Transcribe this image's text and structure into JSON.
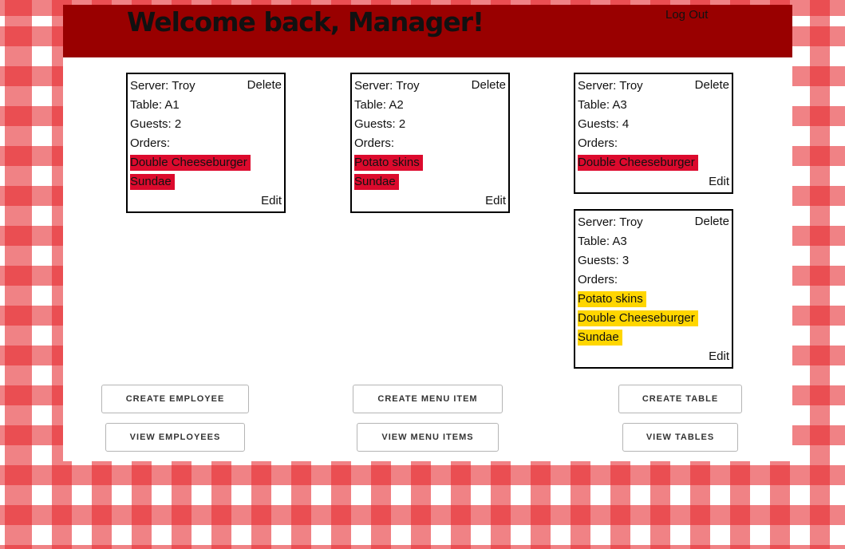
{
  "header": {
    "title": "Welcome back, Manager!",
    "logout_label": "Log Out"
  },
  "cards": [
    {
      "server": "Server: Troy",
      "table": "Table: A1",
      "guests": "Guests: 2",
      "orders_label": "Orders:",
      "orders": [
        "Double Cheeseburger",
        "Sundae"
      ],
      "delete_label": "Delete",
      "edit_label": "Edit"
    },
    {
      "server": "Server: Troy",
      "table": "Table: A2",
      "guests": "Guests: 2",
      "orders_label": "Orders:",
      "orders": [
        "Potato skins",
        "Sundae"
      ],
      "delete_label": "Delete",
      "edit_label": "Edit"
    },
    {
      "server": "Server: Troy",
      "table": "Table: A3",
      "guests": "Guests: 4",
      "orders_label": "Orders:",
      "orders": [
        "Double Cheeseburger"
      ],
      "delete_label": "Delete",
      "edit_label": "Edit"
    },
    {
      "server": "Server: Troy",
      "table": "Table: A3",
      "guests": "Guests: 3",
      "orders_label": "Orders:",
      "orders": [
        "Potato skins",
        "Double Cheeseburger",
        "Sundae"
      ],
      "delete_label": "Delete",
      "edit_label": "Edit"
    }
  ],
  "buttons": {
    "create_employee": "CREATE EMPLOYEE",
    "view_employees": "VIEW EMPLOYEES",
    "create_menu_item": "CREATE MENU ITEM",
    "view_menu_items": "VIEW MENU ITEMS",
    "create_table": "CREATE TABLE",
    "view_tables": "VIEW TABLES"
  },
  "colors": {
    "header_bg": "#990000",
    "order_highlight_red": "#dc0a2d",
    "order_highlight_yellow": "#ffd600",
    "tablecloth_red": "#e6282d"
  }
}
